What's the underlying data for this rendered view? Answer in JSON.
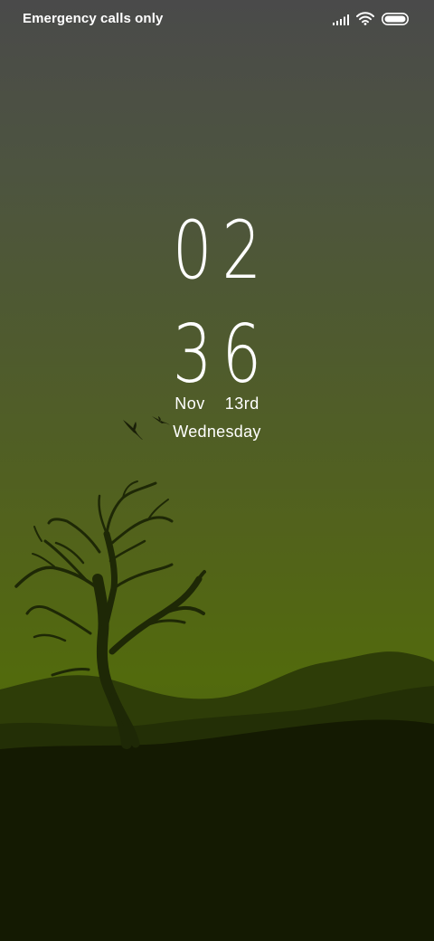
{
  "status_bar": {
    "carrier_text": "Emergency calls only",
    "icons": [
      "signal-icon",
      "wifi-icon",
      "battery-icon"
    ]
  },
  "lock_screen": {
    "hours": "02",
    "minutes": "36",
    "month": "Nov",
    "day": "13rd",
    "weekday": "Wednesday"
  },
  "wallpaper": {
    "description_colors": {
      "sky_top": "#4a4a4a",
      "sky_bottom": "#526a0d",
      "hill_far": "#2f3f08",
      "hill_mid": "#233006",
      "ground": "#141a02",
      "silhouette": "#1f2a06"
    }
  }
}
